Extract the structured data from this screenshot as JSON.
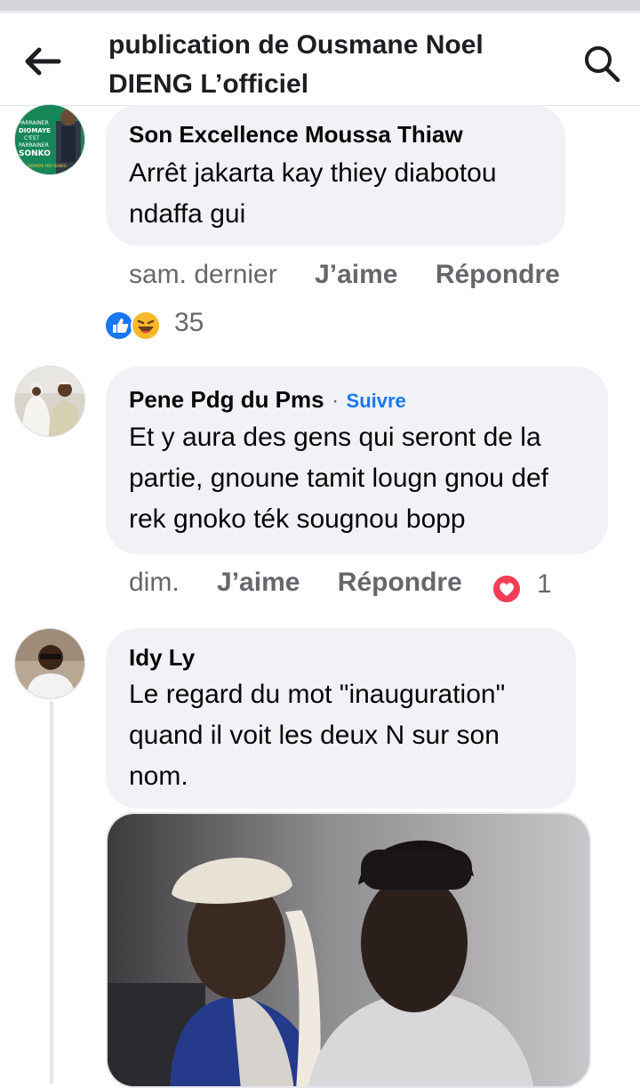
{
  "header": {
    "title": "publication de Ousmane Noel DIENG L’officiel"
  },
  "comments": [
    {
      "author": "Son Excellence Moussa Thiaw",
      "text": "Arrêt jakarta kay thiey diabotou ndaffa gui",
      "time": "sam. dernier",
      "like_label": "J’aime",
      "reply_label": "Répondre",
      "reaction_count": "35",
      "avatar_text": {
        "line1": "PARRAINER",
        "line2": "DIOMAYE",
        "line3": "C'EST",
        "line4": "PARRAINER",
        "line5": "SONKO",
        "line6": "DIOMAYE MOY SONKO"
      }
    },
    {
      "author": "Pene Pdg du Pms",
      "follow_label": "Suivre",
      "separator": "·",
      "text": "Et y aura des gens qui seront de la partie, gnoune tamit lougn gnou def rek gnoko ték sougnou bopp",
      "time": "dim.",
      "like_label": "J’aime",
      "reply_label": "Répondre",
      "reaction_count": "1"
    },
    {
      "author": "Idy Ly",
      "text": "Le regard du mot \"inauguration\" quand il voit les deux N sur son nom."
    }
  ],
  "colors": {
    "bubble": "#f0f2f5",
    "link_blue": "#1877f2",
    "meta_gray": "#65676b",
    "like_blue": "#1877f2",
    "heart_red": "#f33e58",
    "haha_yellow": "#f7b928"
  },
  "icons": [
    "back-arrow-icon",
    "search-icon",
    "like-reaction-icon",
    "haha-reaction-icon",
    "love-reaction-icon"
  ]
}
